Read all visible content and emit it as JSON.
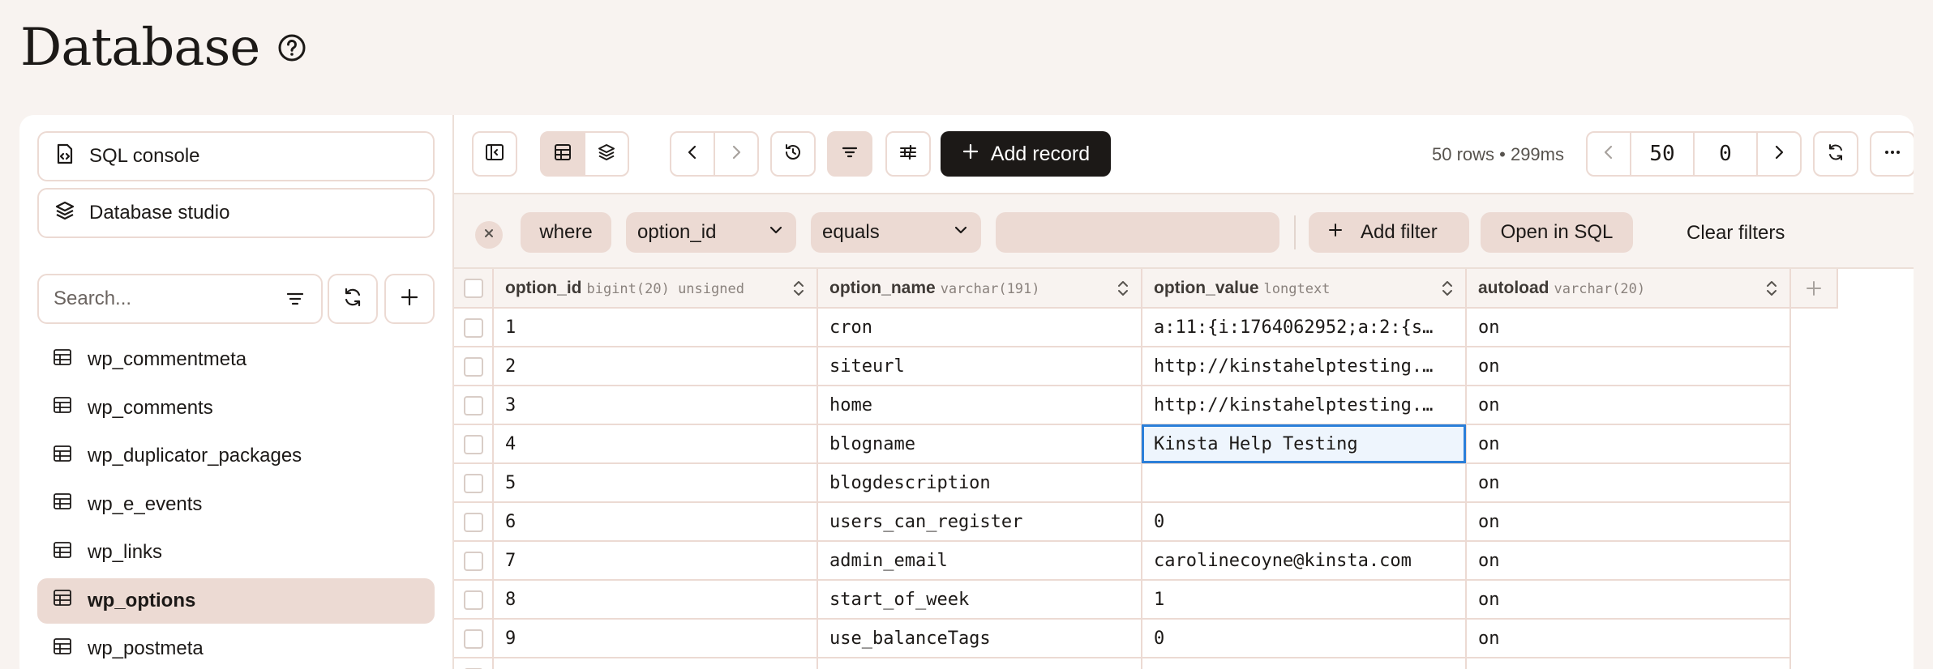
{
  "page": {
    "title": "Database"
  },
  "sidebar": {
    "sql_console": "SQL console",
    "database_studio": "Database studio",
    "search_placeholder": "Search...",
    "tables": [
      {
        "label": "wp_commentmeta",
        "active": false
      },
      {
        "label": "wp_comments",
        "active": false
      },
      {
        "label": "wp_duplicator_packages",
        "active": false
      },
      {
        "label": "wp_e_events",
        "active": false
      },
      {
        "label": "wp_links",
        "active": false
      },
      {
        "label": "wp_options",
        "active": true
      },
      {
        "label": "wp_postmeta",
        "active": false
      }
    ]
  },
  "toolbar": {
    "add_record": "Add record",
    "rows_info": "50 rows • 299ms",
    "limit": "50",
    "offset": "0"
  },
  "filter": {
    "where_label": "where",
    "column": "option_id",
    "operator": "equals",
    "value": "",
    "add_filter": "Add filter",
    "open_in_sql": "Open in SQL",
    "clear_filters": "Clear filters"
  },
  "grid": {
    "columns": [
      {
        "name": "option_id",
        "type": "bigint(20) unsigned"
      },
      {
        "name": "option_name",
        "type": "varchar(191)"
      },
      {
        "name": "option_value",
        "type": "longtext"
      },
      {
        "name": "autoload",
        "type": "varchar(20)"
      }
    ],
    "rows": [
      [
        "1",
        "cron",
        "a:11:{i:1764062952;a:2:{s…",
        "on"
      ],
      [
        "2",
        "siteurl",
        "http://kinstahelptesting.…",
        "on"
      ],
      [
        "3",
        "home",
        "http://kinstahelptesting.…",
        "on"
      ],
      [
        "4",
        "blogname",
        "Kinsta Help Testing",
        "on"
      ],
      [
        "5",
        "blogdescription",
        "",
        "on"
      ],
      [
        "6",
        "users_can_register",
        "0",
        "on"
      ],
      [
        "7",
        "admin_email",
        "carolinecoyne@kinsta.com",
        "on"
      ],
      [
        "8",
        "start_of_week",
        "1",
        "on"
      ],
      [
        "9",
        "use_balanceTags",
        "0",
        "on"
      ],
      [
        "",
        "",
        "",
        ""
      ]
    ],
    "selected_cell": {
      "row": 3,
      "col": 2
    }
  },
  "colors": {
    "accent": "#1c1917",
    "selection": "#2b7fd9",
    "surface": "#ecdad3"
  }
}
